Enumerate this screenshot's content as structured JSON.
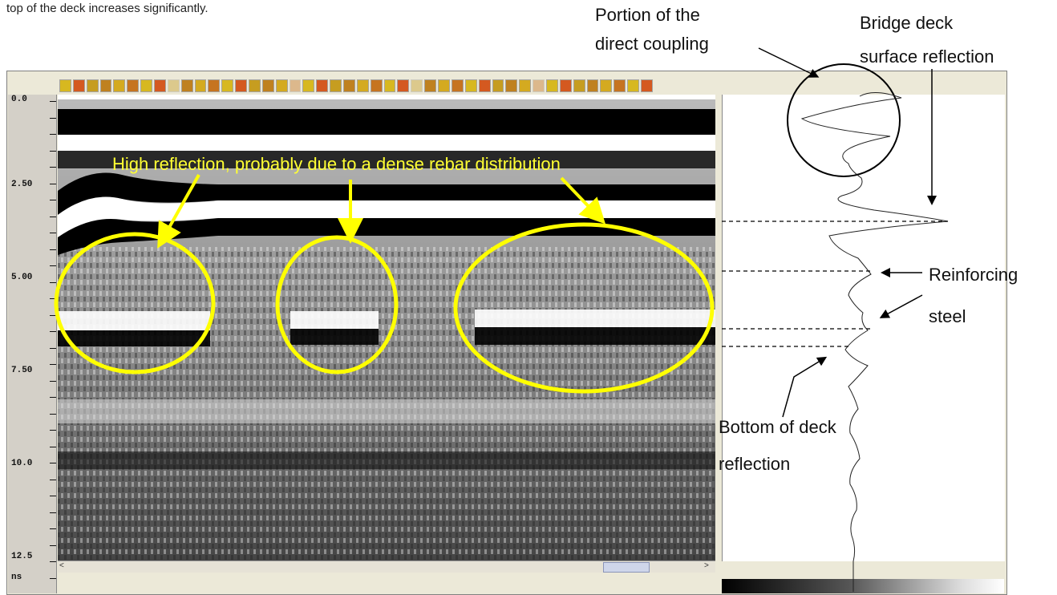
{
  "caption_top": "top of the deck increases significantly.",
  "annotations": {
    "high_reflection": "High reflection, probably due to a dense rebar distribution",
    "direct_coupling_1": "Portion of the",
    "direct_coupling_2": "direct coupling",
    "bridge_deck_1": "Bridge deck",
    "bridge_deck_2": "surface reflection",
    "reinforcing_1": "Reinforcing",
    "reinforcing_2": "steel",
    "bottom_deck_1": "Bottom of deck",
    "bottom_deck_2": "reflection"
  },
  "ruler": {
    "ticks": [
      "0.0",
      "2.50",
      "5.00",
      "7.50",
      "10.0",
      "12.5"
    ],
    "unit": "ns"
  },
  "scroll": {
    "left_arrow": "<",
    "right_arrow": ">"
  },
  "colors": {
    "highlight": "#ffff00",
    "annotation_text": "#ffff33"
  },
  "icons": [
    "toolbar-tool-icon",
    "scroll-left-icon",
    "scroll-right-icon",
    "grip-icon"
  ]
}
